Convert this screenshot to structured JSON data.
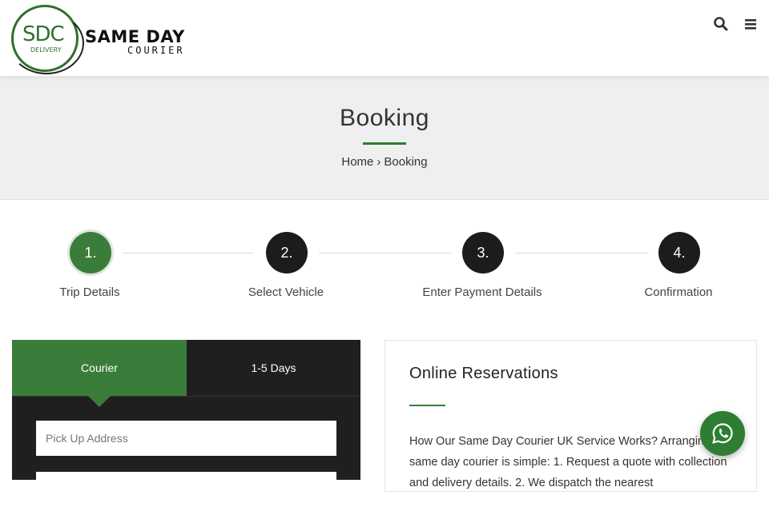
{
  "header": {
    "logo": {
      "mark": "SDC",
      "mark_sub": "DELIVERY",
      "name": "SAME DAY",
      "name_sub": "COURIER"
    },
    "icons": [
      "search-icon",
      "menu-icon"
    ]
  },
  "banner": {
    "title": "Booking",
    "breadcrumb": {
      "home": "Home",
      "separator": "›",
      "current": "Booking"
    }
  },
  "steps": [
    {
      "number": "1.",
      "label": "Trip Details",
      "active": true
    },
    {
      "number": "2.",
      "label": "Select Vehicle",
      "active": false
    },
    {
      "number": "3.",
      "label": "Enter Payment Details",
      "active": false
    },
    {
      "number": "4.",
      "label": "Confirmation",
      "active": false
    }
  ],
  "form": {
    "tabs": [
      {
        "label": "Courier",
        "active": true
      },
      {
        "label": "1-5 Days",
        "active": false
      }
    ],
    "pickup": {
      "placeholder": "Pick Up Address",
      "value": ""
    },
    "dropoff": {
      "placeholder": "",
      "value": ""
    }
  },
  "reservations": {
    "title": "Online Reservations",
    "text": "How Our Same Day Courier UK Service Works? Arranging a same day courier is simple: 1. Request a quote with collection and delivery details. 2. We dispatch the nearest"
  },
  "floating": {
    "whatsapp_icon": "whatsapp-icon"
  },
  "colors": {
    "accent": "#3a7d3a",
    "dark": "#1f1f1f",
    "banner_bg": "#efefef"
  }
}
